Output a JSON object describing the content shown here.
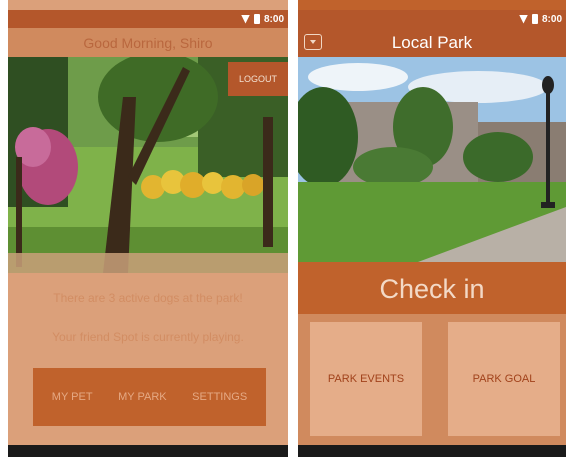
{
  "status_bar": {
    "time": "8:00"
  },
  "screen1": {
    "greeting": "Good Morning, Shiro",
    "logout_label": "LOGOUT",
    "info_lines": [
      "There are 3 active dogs at the park!",
      "Your friend Spot is currently playing."
    ],
    "menu": [
      "MY PET",
      "MY PARK",
      "SETTINGS"
    ]
  },
  "screen2": {
    "title": "Local Park",
    "checkin_label": "Check in",
    "tiles": [
      "PARK EVENTS",
      "PARK GOAL"
    ]
  },
  "colors": {
    "primary_dark": "#b4572b",
    "primary": "#c0622c",
    "light": "#dba07a",
    "tile": "#e5ad89"
  },
  "icons": [
    "wifi-icon",
    "battery-icon",
    "back-icon"
  ]
}
